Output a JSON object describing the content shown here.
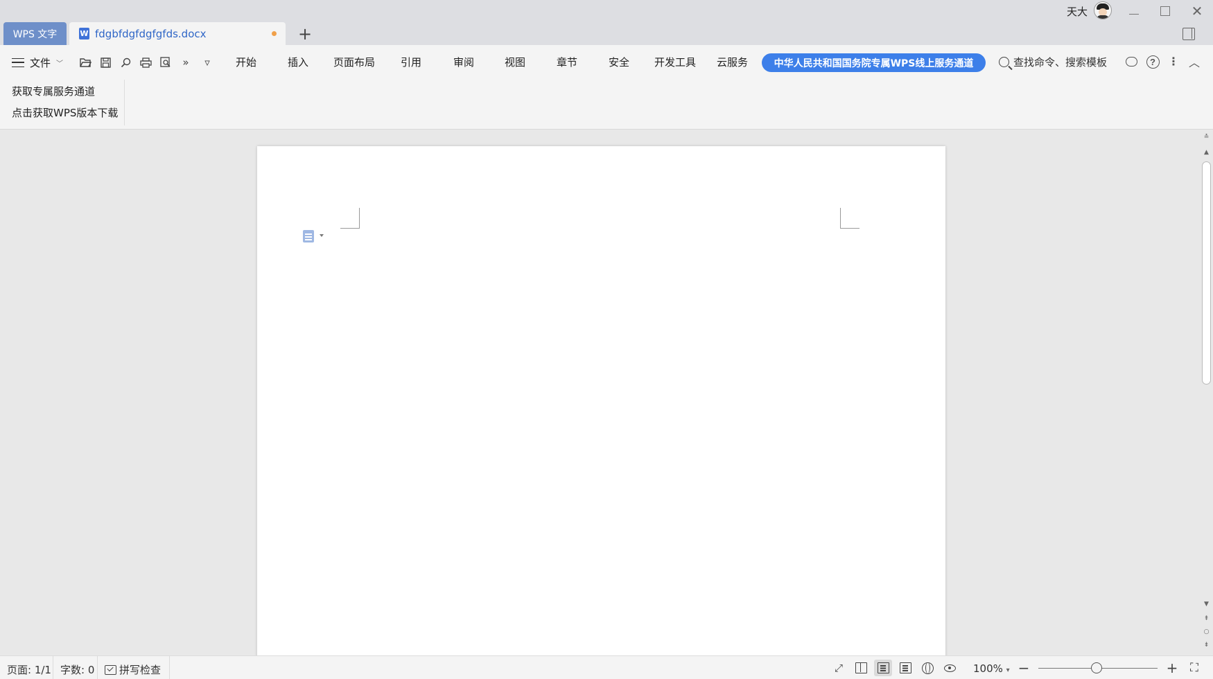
{
  "titlebar": {
    "app_tab": "WPS 文字",
    "doc_tab": {
      "icon": "W",
      "name": "fdgbfdgfdgfgfds.docx",
      "unsaved_color": "#f0a04a"
    },
    "new_tab_symbol": "+",
    "user_name": "天大",
    "close_symbol": "✕"
  },
  "ribbon": {
    "file_menu": "文件",
    "quick_access": [
      "folder-open-icon",
      "save-icon",
      "find-icon",
      "print-icon",
      "print-preview-icon",
      "more-icon",
      "customize-icon"
    ],
    "quick_more_symbol": "»",
    "quick_custom_symbol": "▿",
    "tabs": [
      "开始",
      "插入",
      "页面布局",
      "引用",
      "审阅",
      "视图",
      "章节",
      "安全",
      "开发工具",
      "云服务"
    ],
    "promo": "中华人民共和国国务院专属WPS线上服务通道",
    "search": "查找命令、搜索模板",
    "help_symbol": "?",
    "menu_dots": "⋮",
    "collapse_symbol": "︿",
    "panel": {
      "line1": "获取专属服务通道",
      "line2": "点击获取WPS版本下载"
    }
  },
  "colors": {
    "accent": "#3d7fe9",
    "app_tab": "#6e8fc9",
    "doc_title": "#2f66c7"
  },
  "status": {
    "page": "页面: 1/1",
    "words": "字数: 0",
    "spell": "拼写检查",
    "zoom": "100%",
    "zoom_caret": "▾",
    "zoom_out": "−",
    "zoom_in": "+",
    "fullscreen_symbol": "⛶",
    "expand_symbol": "⤢"
  }
}
